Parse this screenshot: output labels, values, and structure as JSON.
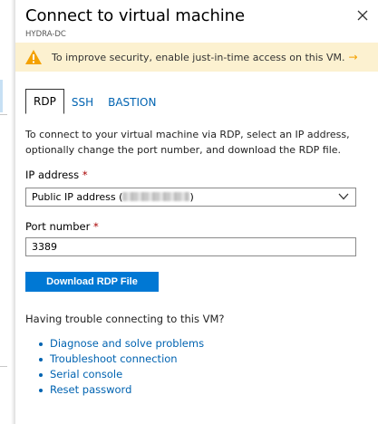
{
  "header": {
    "title": "Connect to virtual machine",
    "subtitle": "HYDRA-DC"
  },
  "banner": {
    "text": "To improve security, enable just-in-time access on this VM.",
    "arrow": "→",
    "icon": "warning-icon"
  },
  "tabs": [
    {
      "label": "RDP",
      "active": true
    },
    {
      "label": "SSH",
      "active": false
    },
    {
      "label": "BASTION",
      "active": false
    }
  ],
  "description": "To connect to your virtual machine via RDP, select an IP address, optionally change the port number, and download the RDP file.",
  "ip_address": {
    "label": "IP address",
    "required_mark": "*",
    "selected_prefix": "Public IP address (",
    "selected_suffix": ")"
  },
  "port_number": {
    "label": "Port number",
    "required_mark": "*",
    "value": "3389"
  },
  "download_button": "Download RDP File",
  "trouble_heading": "Having trouble connecting to this VM?",
  "help_links": [
    "Diagnose and solve problems",
    "Troubleshoot connection",
    "Serial console",
    "Reset password"
  ],
  "colors": {
    "accent": "#0078d4",
    "link": "#0063b1",
    "banner_bg": "#fcf1d0",
    "warning": "#f4a100",
    "required": "#a80000"
  }
}
